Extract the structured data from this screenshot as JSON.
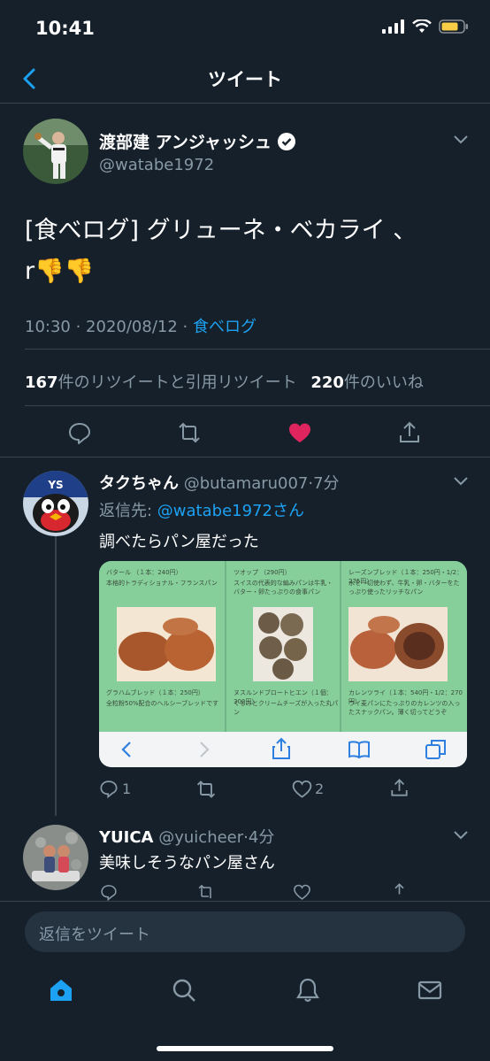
{
  "status_bar": {
    "time": "10:41"
  },
  "nav": {
    "title": "ツイート"
  },
  "tweet": {
    "author_name": "渡部建 アンジャッシュ",
    "author_handle": "@watabe1972",
    "text_line1": "[食べログ] グリューネ・ベカライ 、",
    "text_line2": "r👎👎",
    "time": "10:30 · 2020/08/12 · ",
    "source": "食べログ",
    "retweet_count": "167",
    "retweet_label": "件のリツイートと引用リツイート",
    "like_count": "220",
    "like_label": "件のいいね",
    "liked": true
  },
  "replies": [
    {
      "name": "タクちゃん",
      "handle_time": "@butamaru007·7分",
      "reply_to_prefix": "返信先: ",
      "reply_to": "@watabe1972さん",
      "text": "調べたらパン屋だった",
      "reply_count": "1",
      "like_count": "2",
      "image": {
        "panels": [
          {
            "title": "バタール （１本：240円）",
            "desc": "本格的トラディショナル・フランスパン",
            "caption": "グラハムブレッド（１本：250円）",
            "caption2": "全粒粉50%配合のヘルシーブレッドです"
          },
          {
            "title": "ツオップ （290円）",
            "desc": "スイスの代表的な編みパンは牛乳・バター・卵たっぷりの食事パン",
            "caption": "ヌスルンドブロートヒエン（１個：300円）",
            "caption2": "くるみとクリームチーズが入った丸パン"
          },
          {
            "title": "レーズンブレッド（１本：250円・1/2：275円）",
            "desc": "水を一切使わず、牛乳・卵・バターをたっぷり使ったリッチなパン",
            "caption": "カレンツライ（１本：540円・1/2：270円）",
            "caption2": "ライ麦パンにたっぷりのカレンツの入ったスナックパン。薄く切ってどうぞ"
          }
        ]
      }
    },
    {
      "name": "YUICA",
      "handle_time": "@yuicheer·4分",
      "text": "美味しそうなパン屋さん"
    }
  ],
  "composer": {
    "placeholder": "返信をツイート"
  },
  "tab_bar": {
    "items": [
      "home-icon",
      "search-icon",
      "notifications-icon",
      "messages-icon"
    ]
  },
  "colors": {
    "background": "#15202b",
    "accent": "#1da1f2",
    "like": "#e0245e",
    "muted": "#8899a6",
    "divider": "#38444d"
  }
}
